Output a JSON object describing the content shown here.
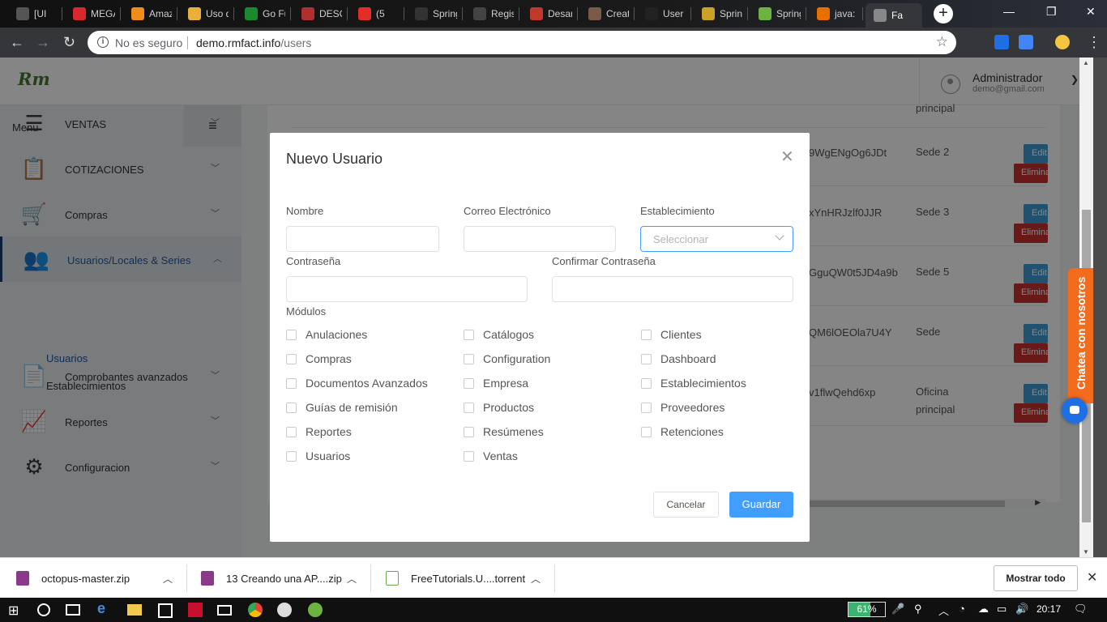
{
  "browser": {
    "tabs": [
      {
        "title": "[UI",
        "color": "#555555"
      },
      {
        "title": "MEGA",
        "color": "#d9272e"
      },
      {
        "title": "Amaz",
        "color": "#f08c1a"
      },
      {
        "title": "Uso d",
        "color": "#e8b03a"
      },
      {
        "title": "Go Fu",
        "color": "#1a8a2c"
      },
      {
        "title": "DESC",
        "color": "#b03030"
      },
      {
        "title": "(5",
        "color": "#e52d27"
      },
      {
        "title": "Spring",
        "color": "#333333"
      },
      {
        "title": "Regist",
        "color": "#444444"
      },
      {
        "title": "Desar",
        "color": "#c0392b"
      },
      {
        "title": "Creat",
        "color": "#7a5a4a"
      },
      {
        "title": "User A",
        "color": "#222222"
      },
      {
        "title": "Spring",
        "color": "#c9a227"
      },
      {
        "title": "Spring",
        "color": "#6db33f"
      },
      {
        "title": "java:",
        "color": "#e76f00"
      },
      {
        "title": "Fa",
        "color": "#888888"
      }
    ],
    "new_tab_label": "+",
    "address": {
      "security_label": "No es seguro",
      "host": "demo.rmfact.info",
      "path": "/users"
    }
  },
  "app": {
    "logo": "Rm",
    "user": {
      "name": "Administrador",
      "email": "demo@gmail.com"
    },
    "sidebar": {
      "menu_label": "Menu",
      "items": [
        {
          "label": "VENTAS",
          "icon": "receipt-icon",
          "glyph": "☰"
        },
        {
          "label": "COTIZACIONES",
          "icon": "clipboard-icon",
          "glyph": "📋"
        },
        {
          "label": "Compras",
          "icon": "cart-icon",
          "glyph": "🛒"
        },
        {
          "label": "Usuarios/Locales & Series",
          "icon": "users-icon",
          "glyph": "👥"
        },
        {
          "label": "Comprobantes avanzados",
          "icon": "document-icon",
          "glyph": "📄"
        },
        {
          "label": "Reportes",
          "icon": "chart-icon",
          "glyph": "📈"
        },
        {
          "label": "Configuracion",
          "icon": "gears-icon",
          "glyph": "⚙"
        }
      ],
      "subitems": [
        "Usuarios",
        "Establecimientos"
      ]
    },
    "background_table": {
      "rows": [
        {
          "token": "",
          "sede": "principal"
        },
        {
          "token": "9WgENgOg6JDt",
          "sede": "Sede 2"
        },
        {
          "token": "xYnHRJzlf0JJR",
          "sede": "Sede 3"
        },
        {
          "token": "GguQW0t5JD4a9b",
          "sede": "Sede 5"
        },
        {
          "token": "QM6lOEOla7U4Y",
          "sede": "Sede"
        },
        {
          "token": "v1flwQehd6xp",
          "sede": "Oficina principal"
        }
      ],
      "edit_label": "Edit",
      "delete_label": "Eliminar"
    },
    "chat": {
      "label": "Chatea con nosotros",
      "color": "#f36b1c"
    }
  },
  "modal": {
    "title": "Nuevo Usuario",
    "fields": {
      "nombre": {
        "label": "Nombre",
        "value": ""
      },
      "correo": {
        "label": "Correo Electrónico",
        "value": ""
      },
      "establecimiento": {
        "label": "Establecimiento",
        "placeholder": "Seleccionar"
      },
      "contrasena": {
        "label": "Contraseña",
        "value": ""
      },
      "confirmar": {
        "label": "Confirmar Contraseña",
        "value": ""
      }
    },
    "modulos_label": "Módulos",
    "modulos": [
      [
        "Anulaciones",
        "Catálogos",
        "Clientes"
      ],
      [
        "Compras",
        "Configuration",
        "Dashboard"
      ],
      [
        "Documentos Avanzados",
        "Empresa",
        "Establecimientos"
      ],
      [
        "Guías de remisión",
        "Productos",
        "Proveedores"
      ],
      [
        "Reportes",
        "Resúmenes",
        "Retenciones"
      ],
      [
        "Usuarios",
        "Ventas",
        ""
      ]
    ],
    "cancel_label": "Cancelar",
    "save_label": "Guardar",
    "accent_color": "#409eff"
  },
  "downloads": {
    "items": [
      "octopus-master.zip",
      "13 Creando una AP....zip",
      "FreeTutorials.U....torrent"
    ],
    "show_all_label": "Mostrar todo"
  },
  "taskbar": {
    "battery_percent": 61,
    "battery_label": "61%",
    "time": "20:17"
  }
}
